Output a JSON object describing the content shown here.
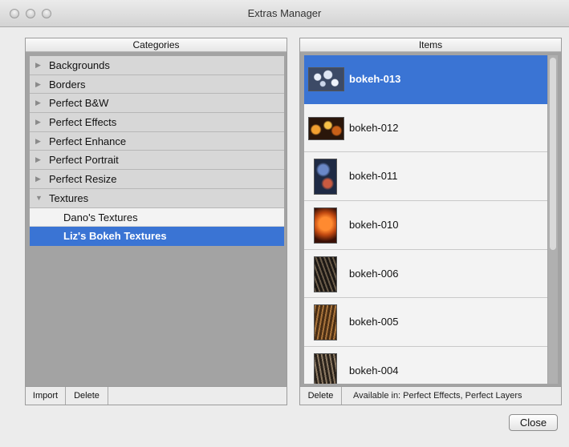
{
  "window": {
    "title": "Extras Manager"
  },
  "categories": {
    "header": "Categories",
    "items": [
      {
        "label": "Backgrounds",
        "icon": "disclosure-right-icon"
      },
      {
        "label": "Borders",
        "icon": "disclosure-right-icon"
      },
      {
        "label": "Perfect B&W",
        "icon": "disclosure-right-icon"
      },
      {
        "label": "Perfect Effects",
        "icon": "disclosure-right-icon"
      },
      {
        "label": "Perfect Enhance",
        "icon": "disclosure-right-icon"
      },
      {
        "label": "Perfect Portrait",
        "icon": "disclosure-right-icon"
      },
      {
        "label": "Perfect Resize",
        "icon": "disclosure-right-icon"
      },
      {
        "label": "Textures",
        "icon": "disclosure-down-icon",
        "expanded": true
      }
    ],
    "subitems": [
      {
        "label": "Dano's Textures"
      },
      {
        "label": "Liz's Bokeh Textures",
        "selected": true
      }
    ],
    "footer": {
      "import_label": "Import",
      "delete_label": "Delete"
    }
  },
  "items": {
    "header": "Items",
    "list": [
      {
        "label": "bokeh-013",
        "selected": true
      },
      {
        "label": "bokeh-012"
      },
      {
        "label": "bokeh-011"
      },
      {
        "label": "bokeh-010"
      },
      {
        "label": "bokeh-006"
      },
      {
        "label": "bokeh-005"
      },
      {
        "label": "bokeh-004"
      }
    ],
    "footer": {
      "delete_label": "Delete",
      "available_text": "Available in: Perfect Effects, Perfect Layers"
    }
  },
  "buttons": {
    "close_label": "Close"
  },
  "colors": {
    "selection": "#3a74d4"
  }
}
